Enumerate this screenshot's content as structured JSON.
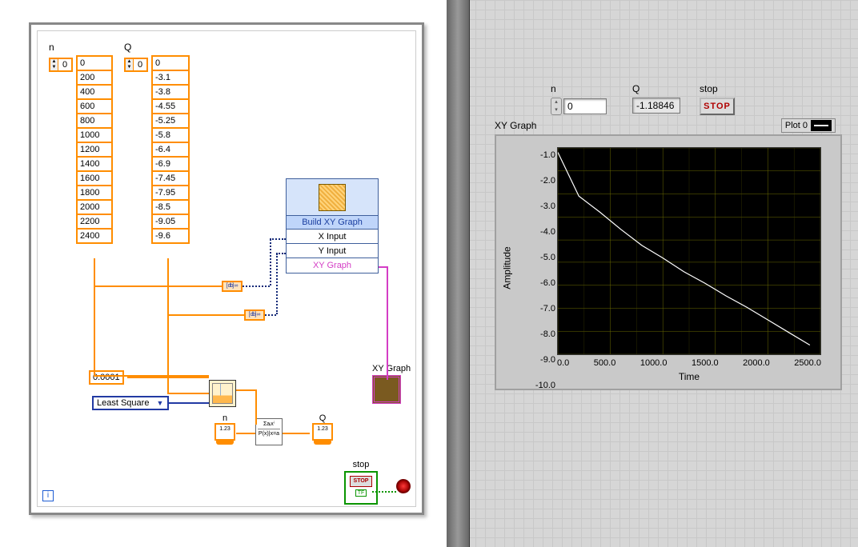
{
  "bd": {
    "arr_n": {
      "label": "n",
      "index": "0",
      "values": [
        "0",
        "200",
        "400",
        "600",
        "800",
        "1000",
        "1200",
        "1400",
        "1600",
        "1800",
        "2000",
        "2200",
        "2400"
      ]
    },
    "arr_q": {
      "label": "Q",
      "index": "0",
      "values": [
        "0",
        "-3.1",
        "-3.8",
        "-4.55",
        "-5.25",
        "-5.8",
        "-6.4",
        "-6.9",
        "-7.45",
        "-7.95",
        "-8.5",
        "-9.05",
        "-9.6"
      ]
    },
    "tol": "0.0001",
    "method": "Least Square",
    "build_xy": {
      "title": "Build XY Graph",
      "xi": "X Input",
      "yi": "Y Input",
      "out": "XY Graph"
    },
    "xy_graph_label": "XY Graph",
    "n_term": {
      "lbl": "n",
      "glyph": "1.23"
    },
    "q_term": {
      "lbl": "Q",
      "glyph": "1.23"
    },
    "poly_top": "Σaᵢxⁱ",
    "poly_bot": "P(x)|x=a",
    "stop": {
      "lbl": "stop",
      "btn": "STOP",
      "tfl": "TF"
    },
    "loop_i": "i"
  },
  "fp": {
    "n": {
      "lbl": "n",
      "val": "0"
    },
    "q": {
      "lbl": "Q",
      "val": "-1.18846"
    },
    "stop": {
      "lbl": "stop",
      "btn": "STOP"
    },
    "graph": {
      "title": "XY Graph",
      "legend": "Plot 0",
      "ylabel": "Amplitude",
      "xlabel": "Time",
      "yticks": [
        "-1.0",
        "-2.0",
        "-3.0",
        "-4.0",
        "-5.0",
        "-6.0",
        "-7.0",
        "-8.0",
        "-9.0",
        "-10.0"
      ],
      "xticks": [
        "0.0",
        "500.0",
        "1000.0",
        "1500.0",
        "2000.0",
        "2500.0"
      ]
    }
  },
  "chart_data": {
    "type": "line",
    "title": "XY Graph",
    "xlabel": "Time",
    "ylabel": "Amplitude",
    "xlim": [
      0,
      2500
    ],
    "ylim": [
      -10,
      -1
    ],
    "legend": "top-right",
    "series": [
      {
        "name": "Plot 0",
        "color": "#ffffff",
        "x": [
          0,
          200,
          400,
          600,
          800,
          1000,
          1200,
          1400,
          1600,
          1800,
          2000,
          2200,
          2400
        ],
        "y": [
          -1.19,
          -3.1,
          -3.8,
          -4.55,
          -5.25,
          -5.8,
          -6.4,
          -6.9,
          -7.45,
          -7.95,
          -8.5,
          -9.05,
          -9.6
        ]
      }
    ]
  }
}
